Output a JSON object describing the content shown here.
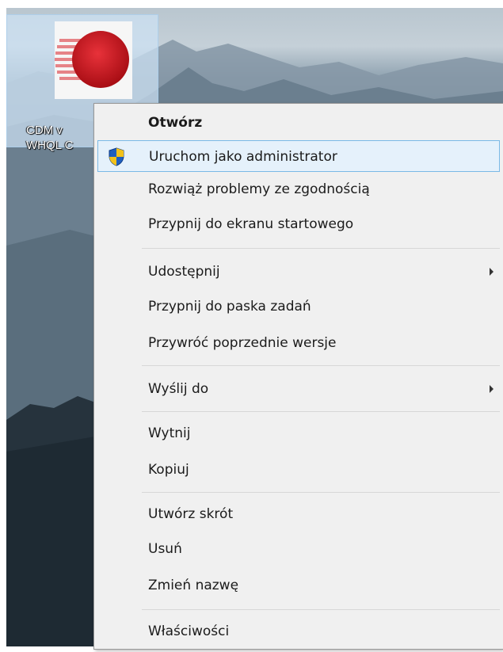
{
  "desktop": {
    "icon": {
      "caption_line1": "CDM v",
      "caption_line2": "WHQL C",
      "logo_icon": "red-sphere-logo-icon"
    }
  },
  "context_menu": {
    "items": [
      {
        "label": "Otwórz",
        "bold": true
      },
      {
        "label": "Uruchom jako administrator",
        "icon": "uac-shield-icon",
        "highlighted": true
      },
      {
        "label": "Rozwiąż problemy ze zgodnością"
      },
      {
        "label": "Przypnij do ekranu startowego"
      },
      {
        "label": "Udostępnij",
        "submenu": true
      },
      {
        "label": "Przypnij do paska zadań"
      },
      {
        "label": "Przywróć poprzednie wersje"
      },
      {
        "label": "Wyślij do",
        "submenu": true
      },
      {
        "label": "Wytnij"
      },
      {
        "label": "Kopiuj"
      },
      {
        "label": "Utwórz skrót"
      },
      {
        "label": "Usuń"
      },
      {
        "label": "Zmień nazwę"
      },
      {
        "label": "Właściwości"
      }
    ]
  },
  "colors": {
    "menu_background": "#f0f0f0",
    "highlight_background": "#e5f1fb",
    "highlight_border": "#7ab9e6",
    "shield_blue": "#1f5fbf",
    "shield_yellow": "#f2c21b",
    "logo_red": "#c8141c"
  }
}
